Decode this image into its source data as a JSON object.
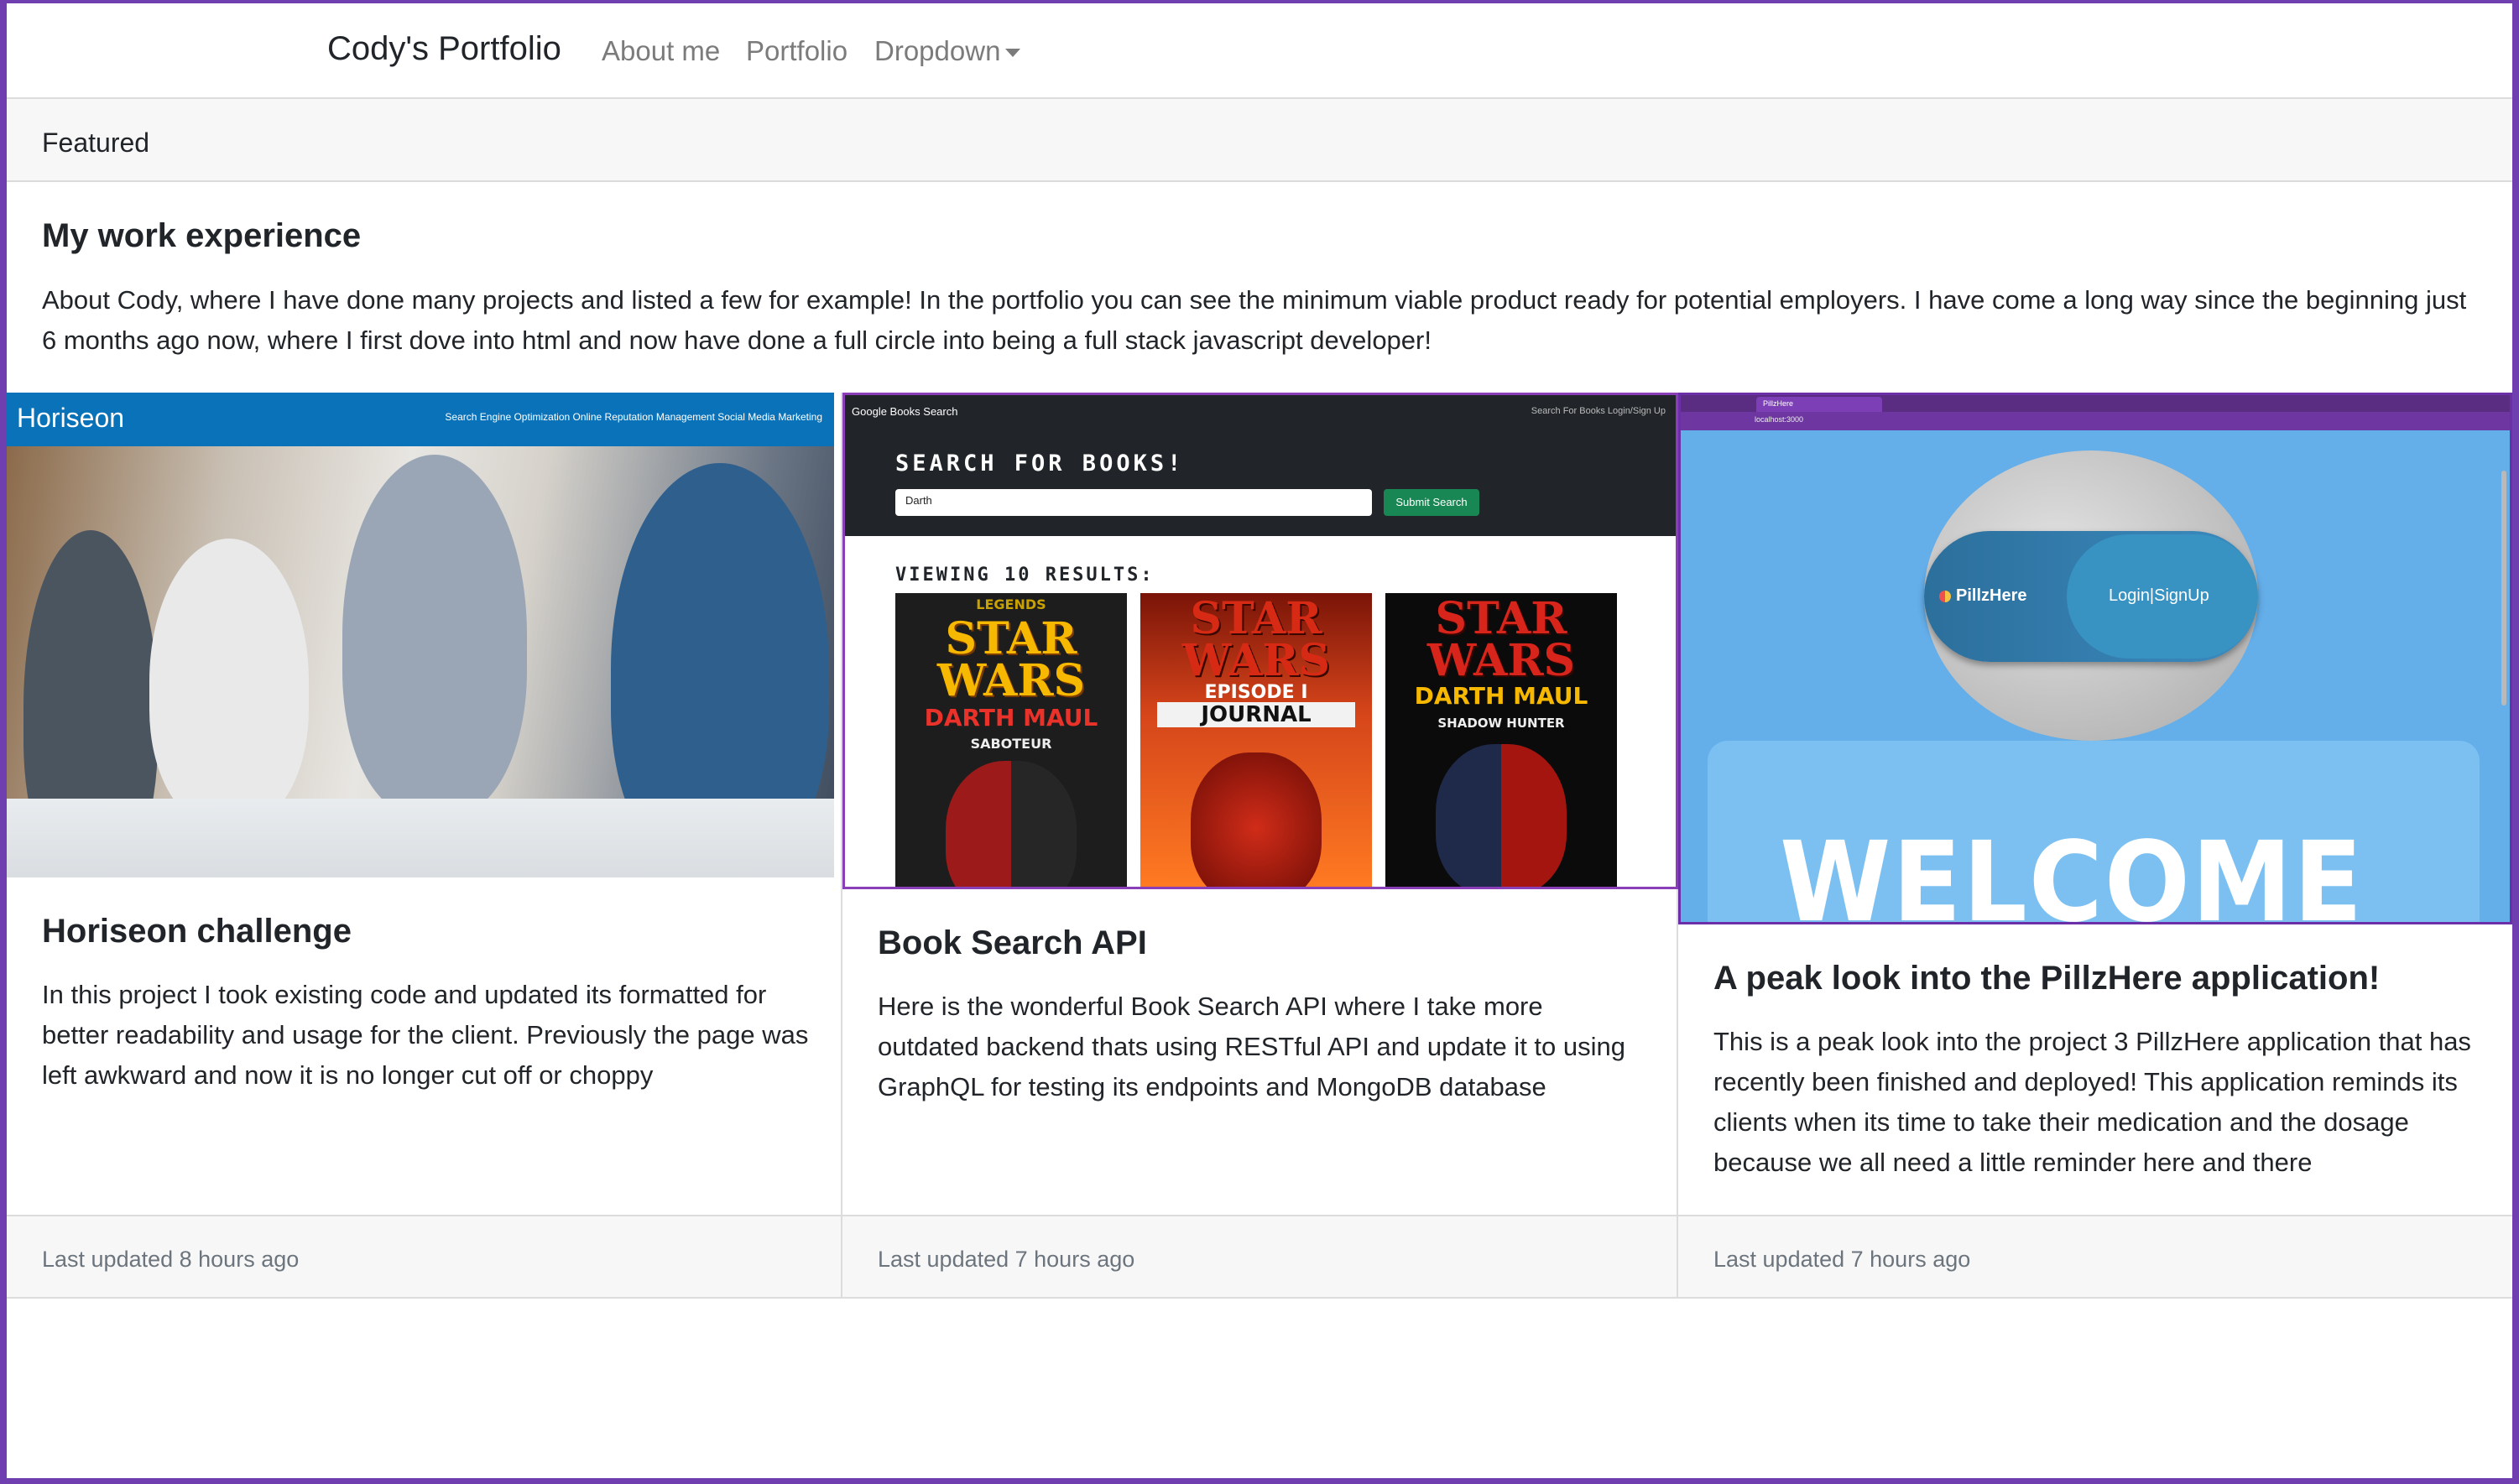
{
  "navbar": {
    "brand": "Cody's Portfolio",
    "links": [
      "About me",
      "Portfolio",
      "Dropdown"
    ]
  },
  "featured": {
    "header": "Featured",
    "title": "My work experience",
    "text": "About Cody, where I have done many projects and listed a few for example! In the portfolio you can see the minimum viable product ready for potential employers. I have come a long way since the beginning just 6 months ago now, where I first dove into html and now have done a full circle into being a full stack javascript developer!"
  },
  "cards": [
    {
      "title": "Horiseon challenge",
      "text": "In this project I took existing code and updated its formatted for better readability and usage for the client. Previously the page was left awkward and now it is no longer cut off or choppy",
      "footer": "Last updated 8 hours ago",
      "image": {
        "logo": "Horiseon",
        "nav": "Search Engine Optimization  Online Reputation Management  Social Media Marketing"
      }
    },
    {
      "title": "Book Search API",
      "text": "Here is the wonderful Book Search API where I take more outdated backend thats using RESTful API and update it to using GraphQL for testing its endpoints and MongoDB database",
      "footer": "Last updated 7 hours ago",
      "image": {
        "app_name": "Google Books Search",
        "nav_right": "Search For Books   Login/Sign Up",
        "heading": "SEARCH FOR BOOKS!",
        "input_value": "Darth",
        "button": "Submit Search",
        "results": "VIEWING 10 RESULTS:",
        "covers": [
          {
            "top": "LEGENDS",
            "title": "STAR WARS",
            "subtitle": "DARTH MAUL",
            "extra": "SABOTEUR"
          },
          {
            "top": "STAR WARS",
            "title": "EPISODE I",
            "subtitle": "JOURNAL",
            "extra": ""
          },
          {
            "top": "",
            "title": "STAR WARS",
            "subtitle": "DARTH MAUL",
            "extra": "SHADOW HUNTER"
          }
        ]
      }
    },
    {
      "title": "A peak look into the PillzHere application!",
      "text": "This is a peak look into the project 3 PillzHere application that has recently been finished and deployed! This application reminds its clients when its time to take their medication and the dosage because we all need a little reminder here and there",
      "footer": "Last updated 7 hours ago",
      "image": {
        "tab": "PillzHere",
        "address": "localhost:3000",
        "logo": "PillzHere",
        "login": "Login|SignUp",
        "welcome": "WELCOME"
      }
    }
  ],
  "colors": {
    "window_border": "#6f3fb0",
    "horiseon_blue": "#0a72b9",
    "books_dark": "#212529",
    "submit_green": "#198754",
    "pillz_sky": "#64aee9"
  }
}
